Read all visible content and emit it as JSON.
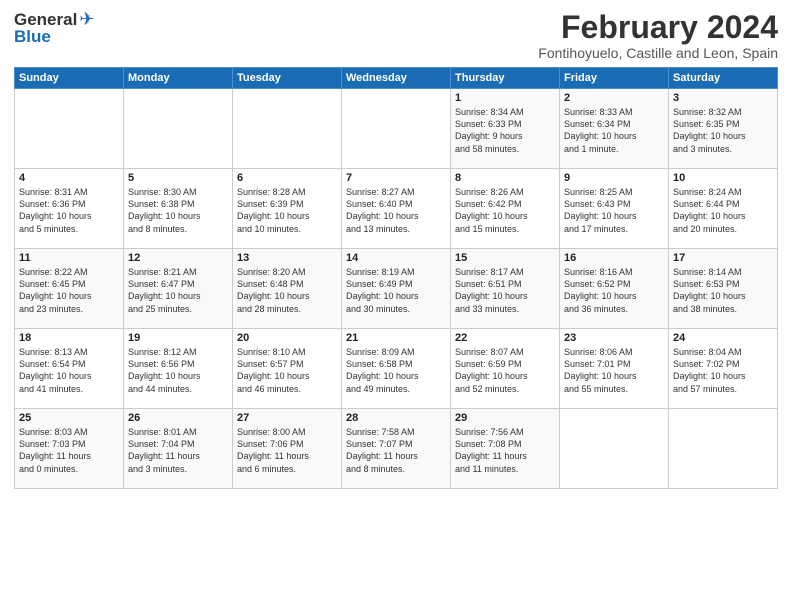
{
  "logo": {
    "general": "General",
    "blue": "Blue"
  },
  "header": {
    "month_year": "February 2024",
    "location": "Fontihoyuelo, Castille and Leon, Spain"
  },
  "days_of_week": [
    "Sunday",
    "Monday",
    "Tuesday",
    "Wednesday",
    "Thursday",
    "Friday",
    "Saturday"
  ],
  "weeks": [
    [
      {
        "day": "",
        "info": ""
      },
      {
        "day": "",
        "info": ""
      },
      {
        "day": "",
        "info": ""
      },
      {
        "day": "",
        "info": ""
      },
      {
        "day": "1",
        "info": "Sunrise: 8:34 AM\nSunset: 6:33 PM\nDaylight: 9 hours\nand 58 minutes."
      },
      {
        "day": "2",
        "info": "Sunrise: 8:33 AM\nSunset: 6:34 PM\nDaylight: 10 hours\nand 1 minute."
      },
      {
        "day": "3",
        "info": "Sunrise: 8:32 AM\nSunset: 6:35 PM\nDaylight: 10 hours\nand 3 minutes."
      }
    ],
    [
      {
        "day": "4",
        "info": "Sunrise: 8:31 AM\nSunset: 6:36 PM\nDaylight: 10 hours\nand 5 minutes."
      },
      {
        "day": "5",
        "info": "Sunrise: 8:30 AM\nSunset: 6:38 PM\nDaylight: 10 hours\nand 8 minutes."
      },
      {
        "day": "6",
        "info": "Sunrise: 8:28 AM\nSunset: 6:39 PM\nDaylight: 10 hours\nand 10 minutes."
      },
      {
        "day": "7",
        "info": "Sunrise: 8:27 AM\nSunset: 6:40 PM\nDaylight: 10 hours\nand 13 minutes."
      },
      {
        "day": "8",
        "info": "Sunrise: 8:26 AM\nSunset: 6:42 PM\nDaylight: 10 hours\nand 15 minutes."
      },
      {
        "day": "9",
        "info": "Sunrise: 8:25 AM\nSunset: 6:43 PM\nDaylight: 10 hours\nand 17 minutes."
      },
      {
        "day": "10",
        "info": "Sunrise: 8:24 AM\nSunset: 6:44 PM\nDaylight: 10 hours\nand 20 minutes."
      }
    ],
    [
      {
        "day": "11",
        "info": "Sunrise: 8:22 AM\nSunset: 6:45 PM\nDaylight: 10 hours\nand 23 minutes."
      },
      {
        "day": "12",
        "info": "Sunrise: 8:21 AM\nSunset: 6:47 PM\nDaylight: 10 hours\nand 25 minutes."
      },
      {
        "day": "13",
        "info": "Sunrise: 8:20 AM\nSunset: 6:48 PM\nDaylight: 10 hours\nand 28 minutes."
      },
      {
        "day": "14",
        "info": "Sunrise: 8:19 AM\nSunset: 6:49 PM\nDaylight: 10 hours\nand 30 minutes."
      },
      {
        "day": "15",
        "info": "Sunrise: 8:17 AM\nSunset: 6:51 PM\nDaylight: 10 hours\nand 33 minutes."
      },
      {
        "day": "16",
        "info": "Sunrise: 8:16 AM\nSunset: 6:52 PM\nDaylight: 10 hours\nand 36 minutes."
      },
      {
        "day": "17",
        "info": "Sunrise: 8:14 AM\nSunset: 6:53 PM\nDaylight: 10 hours\nand 38 minutes."
      }
    ],
    [
      {
        "day": "18",
        "info": "Sunrise: 8:13 AM\nSunset: 6:54 PM\nDaylight: 10 hours\nand 41 minutes."
      },
      {
        "day": "19",
        "info": "Sunrise: 8:12 AM\nSunset: 6:56 PM\nDaylight: 10 hours\nand 44 minutes."
      },
      {
        "day": "20",
        "info": "Sunrise: 8:10 AM\nSunset: 6:57 PM\nDaylight: 10 hours\nand 46 minutes."
      },
      {
        "day": "21",
        "info": "Sunrise: 8:09 AM\nSunset: 6:58 PM\nDaylight: 10 hours\nand 49 minutes."
      },
      {
        "day": "22",
        "info": "Sunrise: 8:07 AM\nSunset: 6:59 PM\nDaylight: 10 hours\nand 52 minutes."
      },
      {
        "day": "23",
        "info": "Sunrise: 8:06 AM\nSunset: 7:01 PM\nDaylight: 10 hours\nand 55 minutes."
      },
      {
        "day": "24",
        "info": "Sunrise: 8:04 AM\nSunset: 7:02 PM\nDaylight: 10 hours\nand 57 minutes."
      }
    ],
    [
      {
        "day": "25",
        "info": "Sunrise: 8:03 AM\nSunset: 7:03 PM\nDaylight: 11 hours\nand 0 minutes."
      },
      {
        "day": "26",
        "info": "Sunrise: 8:01 AM\nSunset: 7:04 PM\nDaylight: 11 hours\nand 3 minutes."
      },
      {
        "day": "27",
        "info": "Sunrise: 8:00 AM\nSunset: 7:06 PM\nDaylight: 11 hours\nand 6 minutes."
      },
      {
        "day": "28",
        "info": "Sunrise: 7:58 AM\nSunset: 7:07 PM\nDaylight: 11 hours\nand 8 minutes."
      },
      {
        "day": "29",
        "info": "Sunrise: 7:56 AM\nSunset: 7:08 PM\nDaylight: 11 hours\nand 11 minutes."
      },
      {
        "day": "",
        "info": ""
      },
      {
        "day": "",
        "info": ""
      }
    ]
  ]
}
